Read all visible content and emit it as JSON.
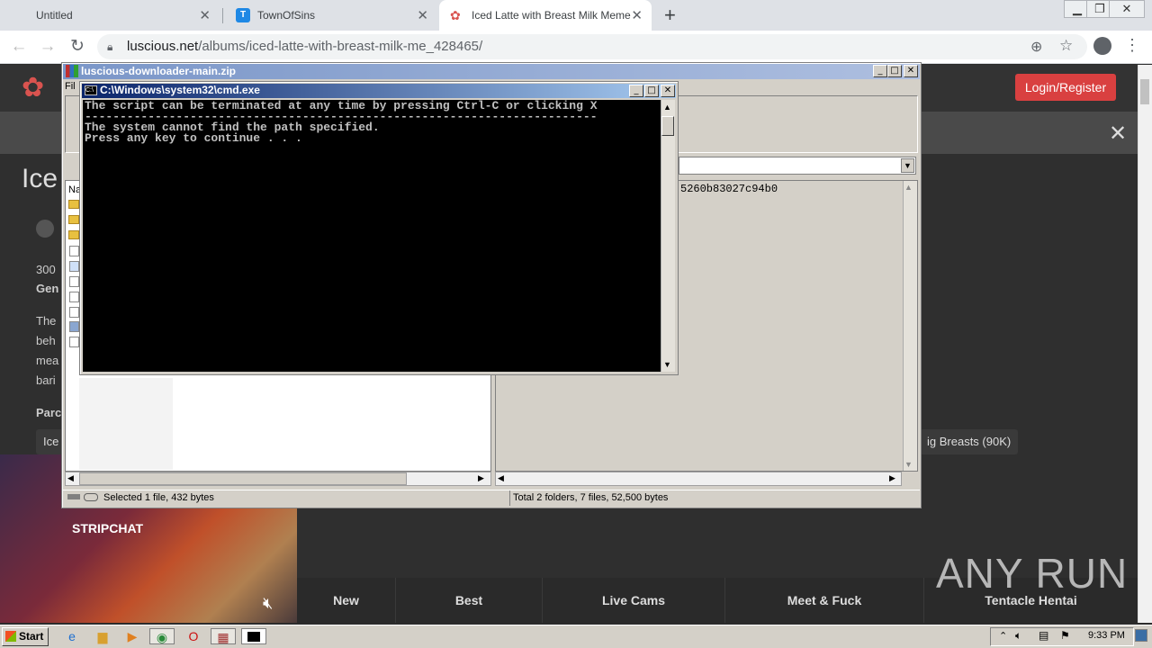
{
  "browser": {
    "tabs": [
      {
        "title": "Untitled",
        "active": false
      },
      {
        "title": "TownOfSins",
        "active": false
      },
      {
        "title": "Iced Latte with Breast Milk Meme | Lu",
        "active": true
      }
    ],
    "new_tab_icon": "plus-icon",
    "window_controls": [
      "minimize",
      "restore",
      "close"
    ],
    "url_host": "luscious.net",
    "url_path": "/albums/iced-latte-with-breast-milk-me_428465/"
  },
  "site": {
    "login_label": "Login/Register",
    "page_title": "Ice",
    "meta_count": "300",
    "meta_genre": "Gen",
    "desc_lines": [
      "The",
      "beh",
      "mea",
      "bari"
    ],
    "section_label": "Parc",
    "chip_left": "Ice",
    "chip_right": "ig Breasts (90K)",
    "nav": [
      "New",
      "Best",
      "Live Cams",
      "Meet & Fuck",
      "Tentacle Hentai"
    ],
    "cam_brand": "STRIPCHAT",
    "watermark": "ANY RUN"
  },
  "winrar": {
    "title": "luscious-downloader-main.zip",
    "menu_first": "Fil",
    "list_header": "Na",
    "hash_fragment": "5260b83027c94b0",
    "status_left": "Selected 1 file, 432 bytes",
    "status_right": "Total 2 folders, 7 files, 52,500 bytes"
  },
  "cmd": {
    "title": "C:\\Windows\\system32\\cmd.exe",
    "lines": [
      "The script can be terminated at any time by pressing Ctrl-C or clicking X",
      "-------------------------------------------------------------------------",
      "The system cannot find the path specified.",
      "Press any key to continue . . ."
    ]
  },
  "taskbar": {
    "start_label": "Start",
    "clock": "9:33 PM"
  }
}
